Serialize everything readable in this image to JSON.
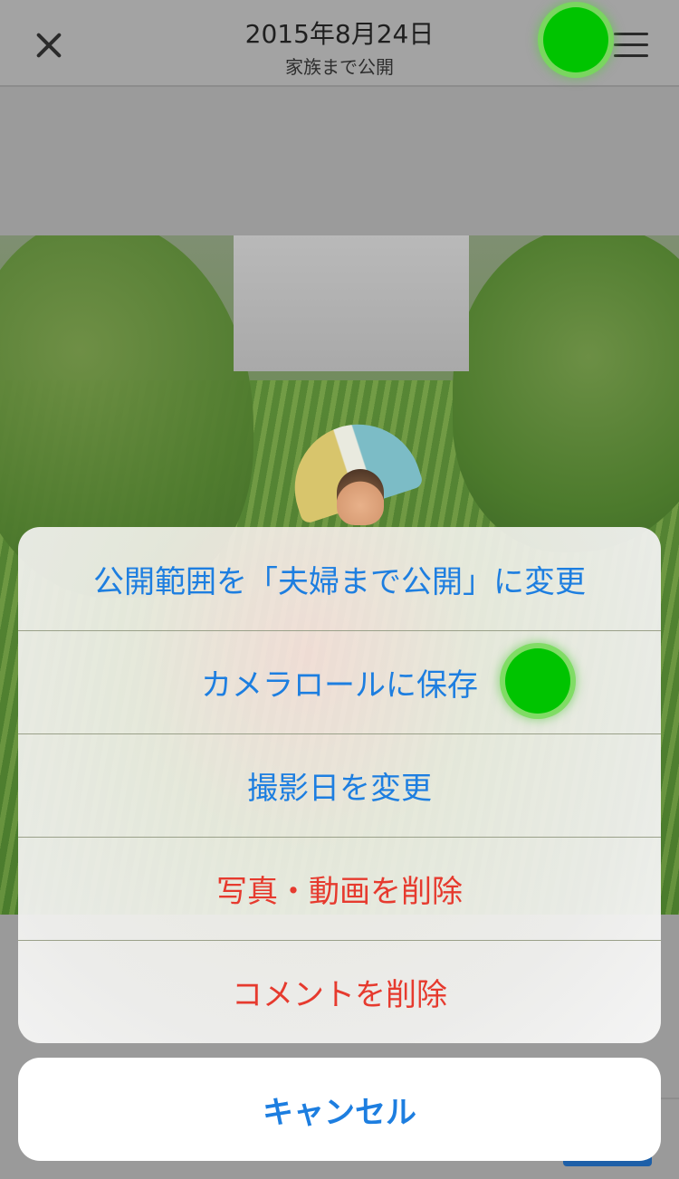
{
  "header": {
    "title": "2015年8月24日",
    "subtitle": "家族まで公開"
  },
  "action_sheet": {
    "items": [
      {
        "label": "公開範囲を「夫婦まで公開」に変更",
        "color": "#1d7ee0"
      },
      {
        "label": "カメラロールに保存",
        "color": "#1d7ee0"
      },
      {
        "label": "撮影日を変更",
        "color": "#1d7ee0"
      },
      {
        "label": "写真・動画を削除",
        "color": "#e63a2e"
      },
      {
        "label": "コメントを削除",
        "color": "#e63a2e"
      }
    ],
    "cancel_label": "キャンセル"
  },
  "icons": {
    "close": "close-icon",
    "menu": "hamburger-menu-icon"
  },
  "colors": {
    "action_blue": "#1d7ee0",
    "destructive_red": "#e63a2e",
    "tap_indicator": "#00c400"
  }
}
